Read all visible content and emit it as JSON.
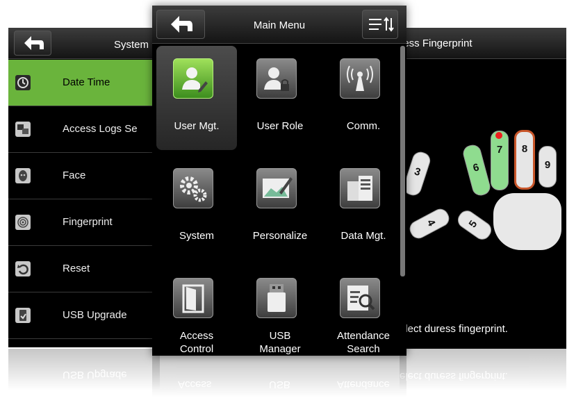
{
  "left_screen": {
    "title": "System",
    "items": [
      {
        "label": "Date Time",
        "icon": "clock-icon",
        "selected": true
      },
      {
        "label": "Access Logs Se",
        "icon": "logs-icon"
      },
      {
        "label": "Face",
        "icon": "face-icon"
      },
      {
        "label": "Fingerprint",
        "icon": "fingerprint-icon"
      },
      {
        "label": "Reset",
        "icon": "reset-icon"
      },
      {
        "label": "USB Upgrade",
        "icon": "usb-upgrade-icon"
      }
    ],
    "reflection_label": "USB Upgrade"
  },
  "center_screen": {
    "title": "Main Menu",
    "items": [
      {
        "label": "User Mgt.",
        "icon": "user-mgt-icon",
        "selected": true
      },
      {
        "label": "User Role",
        "icon": "user-role-icon"
      },
      {
        "label": "Comm.",
        "icon": "comm-icon"
      },
      {
        "label": "System",
        "icon": "system-gear-icon"
      },
      {
        "label": "Personalize",
        "icon": "personalize-icon"
      },
      {
        "label": "Data Mgt.",
        "icon": "data-mgt-icon"
      },
      {
        "label": "Access Control",
        "label_line1": "Access",
        "label_line2": "Control",
        "icon": "access-control-icon"
      },
      {
        "label": "USB Manager",
        "label_line1": "USB",
        "label_line2": "Manager",
        "icon": "usb-manager-icon"
      },
      {
        "label": "Attendance Search",
        "label_line1": "Attendance",
        "label_line2": "Search",
        "icon": "attendance-search-icon"
      }
    ],
    "reflection": {
      "col1": "Access",
      "col2": "USB",
      "col3": "Attendance"
    }
  },
  "right_screen": {
    "title": "uress Fingerprint",
    "hint": "elect duress fingerprint.",
    "fingers": [
      {
        "number": "3",
        "state": "none"
      },
      {
        "number": "4",
        "state": "none"
      },
      {
        "number": "5",
        "state": "none"
      },
      {
        "number": "6",
        "state": "enrolled"
      },
      {
        "number": "7",
        "state": "enrolled"
      },
      {
        "number": "8",
        "state": "selected"
      },
      {
        "number": "9",
        "state": "none"
      }
    ],
    "reflection_hint": "elect duress fingerprint."
  },
  "colors": {
    "selected_bg": "#6ab43c",
    "enrolled_finger": "#8fdc8f",
    "selected_finger_border": "#c8562a",
    "marker_dot": "#ee1e1e"
  }
}
